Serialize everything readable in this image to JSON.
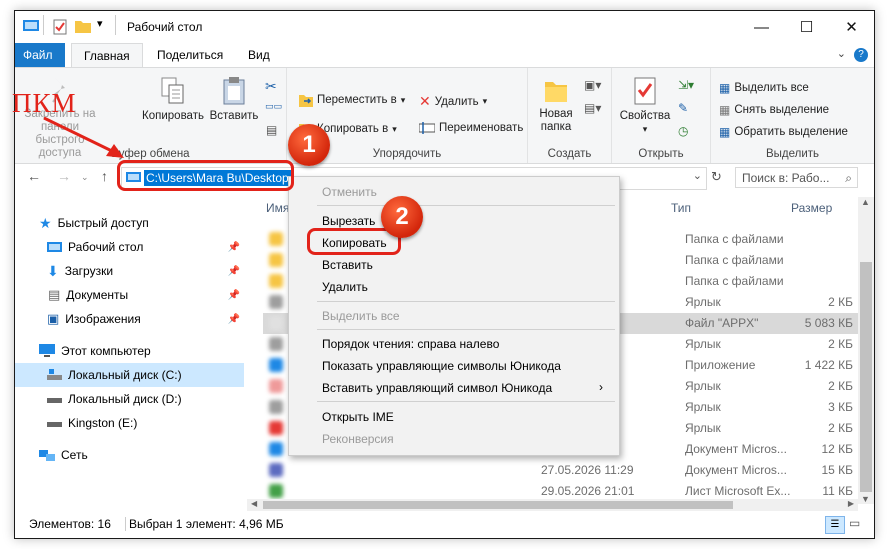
{
  "window": {
    "title": "Рабочий стол",
    "controls": [
      "—",
      "☐",
      "✕"
    ]
  },
  "ribbon_tabs": [
    "Файл",
    "Главная",
    "Поделиться",
    "Вид"
  ],
  "ribbon": {
    "clipboard": {
      "pin_label": "Закрепить на панели быстрого доступа",
      "copy_label": "Копировать",
      "paste_label": "Вставить",
      "group_label": "Буфер обмена"
    },
    "organize": {
      "move_label": "Переместить в",
      "copy_to_label": "Копировать в",
      "delete_label": "Удалить",
      "rename_label": "Переименовать",
      "group_label": "Упорядочить"
    },
    "create": {
      "new_folder_label": "Новая папка",
      "group_label": "Создать"
    },
    "open": {
      "properties_label": "Свойства",
      "group_label": "Открыть"
    },
    "select": {
      "select_all": "Выделить все",
      "select_none": "Снять выделение",
      "invert": "Обратить выделение",
      "group_label": "Выделить"
    }
  },
  "address": {
    "path": "C:\\Users\\Mara Bu\\Desktop",
    "search_placeholder": "Поиск в: Рабо..."
  },
  "nav_pane": {
    "quick_access": "Быстрый доступ",
    "items": [
      "Рабочий стол",
      "Загрузки",
      "Документы",
      "Изображения"
    ],
    "this_pc": "Этот компьютер",
    "drives": [
      "Локальный диск (C:)",
      "Локальный диск (D:)",
      "Kingston (E:)"
    ],
    "network": "Сеть"
  },
  "file_list": {
    "columns": {
      "name": "Имя",
      "type": "Тип",
      "size": "Размер"
    },
    "rows": [
      {
        "date": "",
        "type": "Папка с файлами",
        "size": ""
      },
      {
        "date": "",
        "type": "Папка с файлами",
        "size": ""
      },
      {
        "date": "",
        "type": "Папка с файлами",
        "size": ""
      },
      {
        "date": "",
        "type": "Ярлык",
        "size": "2 КБ"
      },
      {
        "date": "",
        "type": "Файл \"APPX\"",
        "size": "5 083 КБ"
      },
      {
        "date": "",
        "type": "Ярлык",
        "size": "2 КБ"
      },
      {
        "date": "",
        "type": "Приложение",
        "size": "1 422 КБ"
      },
      {
        "date": "",
        "type": "Ярлык",
        "size": "2 КБ"
      },
      {
        "date": "",
        "type": "Ярлык",
        "size": "3 КБ"
      },
      {
        "date": "",
        "type": "Ярлык",
        "size": "2 КБ"
      },
      {
        "date": "",
        "type": "Документ Micros...",
        "size": "12 КБ"
      },
      {
        "date": "27.05.2026 11:29",
        "type": "Документ Micros...",
        "size": "15 КБ"
      },
      {
        "date": "29.05.2026 21:01",
        "type": "Лист Microsoft Ex...",
        "size": "11 КБ"
      }
    ]
  },
  "status": {
    "count": "Элементов: 16",
    "selected": "Выбран 1 элемент: 4,96 МБ"
  },
  "context_menu": {
    "undo": "Отменить",
    "cut": "Вырезать",
    "copy": "Копировать",
    "paste": "Вставить",
    "delete": "Удалить",
    "select_all": "Выделить все",
    "rtl": "Порядок чтения: справа налево",
    "show_unicode": "Показать управляющие символы Юникода",
    "insert_unicode": "Вставить управляющий символ Юникода",
    "open_ime": "Открыть IME",
    "reconversion": "Реконверсия"
  },
  "annotations": {
    "rmb": "ПКМ",
    "step1": "1",
    "step2": "2"
  }
}
